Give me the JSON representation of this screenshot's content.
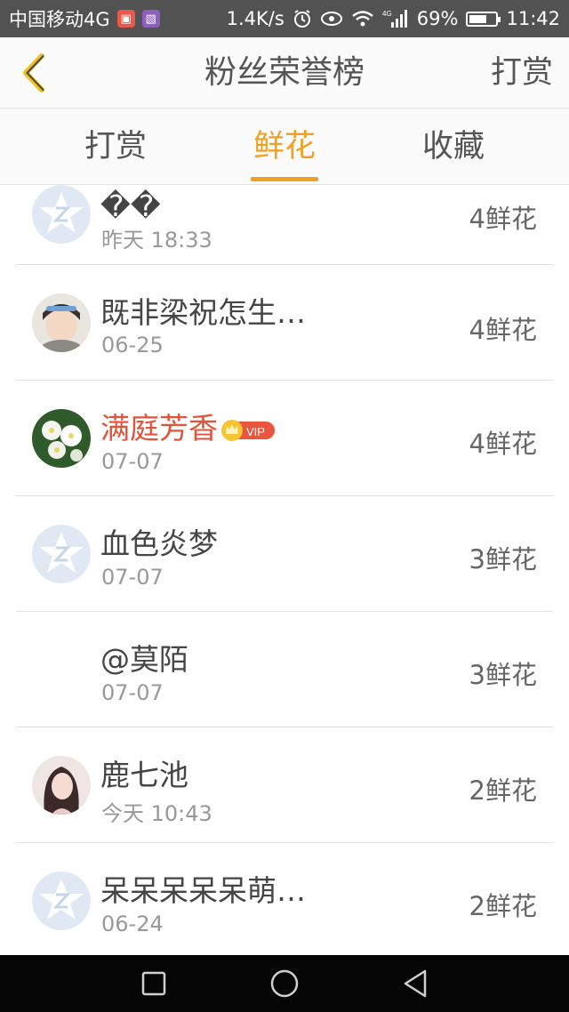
{
  "status_bar": {
    "carrier": "中国移动4G",
    "net_speed": "1.4K/s",
    "net_type": "4G",
    "battery": "69%",
    "battery_level": 0.69,
    "time": "11:42"
  },
  "header": {
    "title": "粉丝荣誉榜",
    "back_icon": "chevron-left-icon",
    "action_label": "打赏"
  },
  "tabs": [
    {
      "label": "打赏",
      "active": false
    },
    {
      "label": "鲜花",
      "active": true
    },
    {
      "label": "收藏",
      "active": false
    }
  ],
  "accent_color": "#f0a023",
  "vip_name_color": "#e2533a",
  "fans": [
    {
      "name": "��",
      "date": "昨天 18:33",
      "count": "4鲜花",
      "avatar": "default-star-avatar",
      "vip": false
    },
    {
      "name": "既非梁祝怎生…",
      "date": "06-25",
      "count": "4鲜花",
      "avatar": "photo-avatar-girl",
      "vip": false
    },
    {
      "name": "满庭芳香",
      "date": "07-07",
      "count": "4鲜花",
      "avatar": "photo-avatar-flower",
      "vip": true,
      "vip_label": "VIP"
    },
    {
      "name": "血色炎梦",
      "date": "07-07",
      "count": "3鲜花",
      "avatar": "default-star-avatar",
      "vip": false
    },
    {
      "name": "@莫陌",
      "date": "07-07",
      "count": "3鲜花",
      "avatar": "",
      "vip": false
    },
    {
      "name": "鹿七池",
      "date": "今天 10:43",
      "count": "2鲜花",
      "avatar": "photo-avatar-woman",
      "vip": false
    },
    {
      "name": "呆呆呆呆呆萌…",
      "date": "06-24",
      "count": "2鲜花",
      "avatar": "default-star-avatar",
      "vip": false
    }
  ],
  "nav_bar": [
    "square-icon",
    "circle-icon",
    "triangle-back-icon"
  ]
}
